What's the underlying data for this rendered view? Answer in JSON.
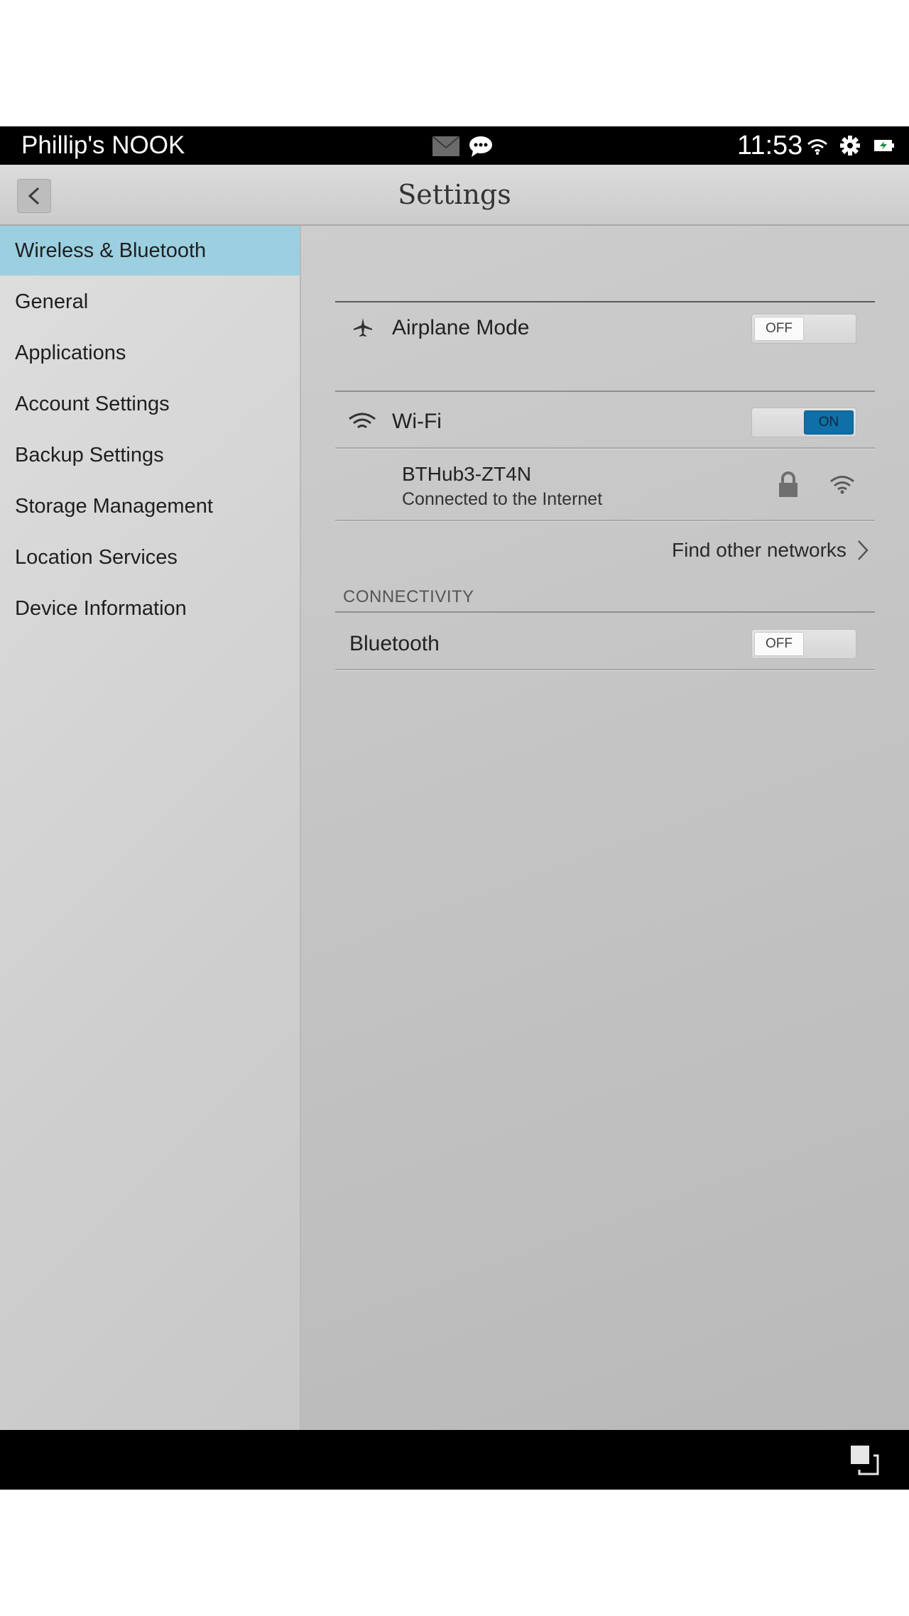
{
  "status_bar": {
    "device_name": "Phillip's NOOK",
    "time": "11:53",
    "notification_icons": [
      "mail-icon",
      "chat-icon"
    ],
    "system_icons": [
      "wifi-icon",
      "gear-icon",
      "battery-charging-icon"
    ]
  },
  "header": {
    "title": "Settings",
    "back_icon": "chevron-left-icon"
  },
  "sidebar": {
    "items": [
      {
        "label": "Wireless & Bluetooth",
        "active": true
      },
      {
        "label": "General"
      },
      {
        "label": "Applications"
      },
      {
        "label": "Account Settings"
      },
      {
        "label": "Backup Settings"
      },
      {
        "label": "Storage Management"
      },
      {
        "label": "Location Services"
      },
      {
        "label": "Device Information"
      }
    ]
  },
  "main": {
    "airplane_mode": {
      "label": "Airplane Mode",
      "icon": "airplane-icon",
      "state": "OFF"
    },
    "wifi": {
      "label": "Wi-Fi",
      "icon": "wifi-icon",
      "state": "ON"
    },
    "network": {
      "name": "BTHub3-ZT4N",
      "status": "Connected to the Internet",
      "icons": [
        "lock-icon",
        "wifi-signal-icon"
      ]
    },
    "find_other_networks": "Find other networks",
    "connectivity_header": "CONNECTIVITY",
    "bluetooth": {
      "label": "Bluetooth",
      "state": "OFF"
    }
  },
  "colors": {
    "active_item": "#9ccfe0",
    "toggle_on": "#0f6fa6",
    "bar": "#000000"
  }
}
